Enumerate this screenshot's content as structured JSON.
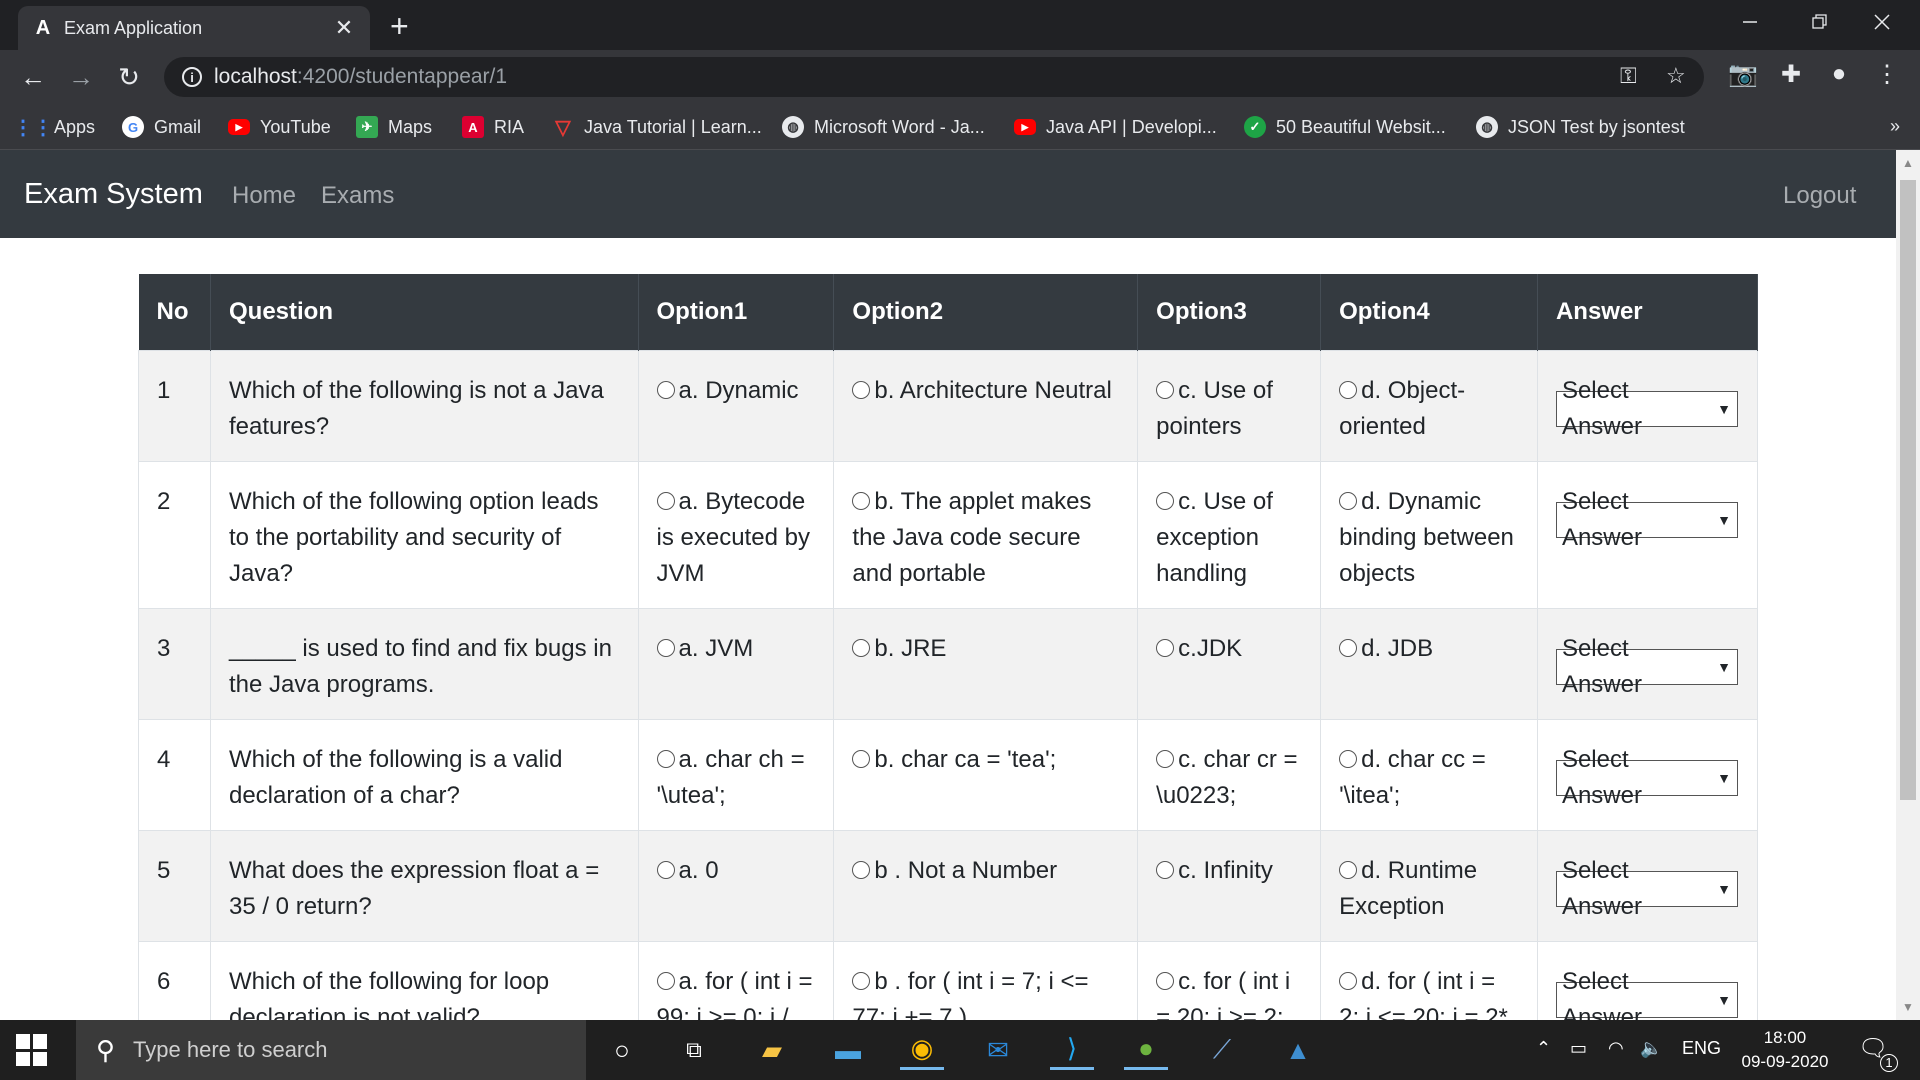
{
  "browser": {
    "tab_title": "Exam Application",
    "tab_close": "✕",
    "new_tab": "+",
    "url_host": "localhost",
    "url_path": ":4200/studentappear/1",
    "bookmarks": [
      {
        "label": "Apps",
        "icon": "apps-grid-icon",
        "color": "#4285f4"
      },
      {
        "label": "Gmail",
        "icon": "google-icon",
        "color": "#ea4335"
      },
      {
        "label": "YouTube",
        "icon": "youtube-icon",
        "color": "#ff0000"
      },
      {
        "label": "Maps",
        "icon": "maps-icon",
        "color": "#34a853"
      },
      {
        "label": "RIA",
        "icon": "angular-icon",
        "color": "#dd0031"
      },
      {
        "label": "Java Tutorial | Learn...",
        "icon": "java-tutorial-icon",
        "color": "#e53935"
      },
      {
        "label": "Microsoft Word - Ja...",
        "icon": "globe-icon",
        "color": "#e8eaed"
      },
      {
        "label": "Java API | Developi...",
        "icon": "youtube-icon",
        "color": "#ff0000"
      },
      {
        "label": "50 Beautiful Websit...",
        "icon": "check-icon",
        "color": "#1ea446"
      },
      {
        "label": "JSON Test by jsontest",
        "icon": "globe-icon",
        "color": "#e8eaed"
      }
    ],
    "bookmarks_more": "»"
  },
  "app": {
    "brand": "Exam System",
    "nav": [
      "Home",
      "Exams"
    ],
    "logout": "Logout"
  },
  "table": {
    "headers": [
      "No",
      "Question",
      "Option1",
      "Option2",
      "Option3",
      "Option4",
      "Answer"
    ],
    "select_placeholder": "Select Answer",
    "rows": [
      {
        "no": "1",
        "question": "Which of the following is not a Java features?",
        "options": [
          "a. Dynamic",
          "b. Architecture Neutral",
          "c. Use of pointers",
          "d. Object-oriented"
        ]
      },
      {
        "no": "2",
        "question": "Which of the following option leads to the portability and security of Java?",
        "options": [
          "a. Bytecode is executed by JVM",
          "b. The applet makes the Java code secure and portable",
          "c. Use of exception handling",
          "d. Dynamic binding between objects"
        ]
      },
      {
        "no": "3",
        "question": "_____ is used to find and fix bugs in the Java programs.",
        "options": [
          "a. JVM",
          "b. JRE",
          "c.JDK",
          "d. JDB"
        ]
      },
      {
        "no": "4",
        "question": "Which of the following is a valid declaration of a char?",
        "options": [
          "a. char ch = '\\utea';",
          "b. char ca = 'tea';",
          "c. char cr = \\u0223;",
          "d. char cc = '\\itea';"
        ]
      },
      {
        "no": "5",
        "question": "What does the expression float a = 35 / 0 return?",
        "options": [
          "a. 0",
          "b . Not a Number",
          "c. Infinity",
          "d. Runtime Exception"
        ]
      },
      {
        "no": "6",
        "question": "Which of the following for loop declaration is not valid?",
        "options": [
          "a. for ( int i = 99; i >= 0; i /",
          "b . for ( int i = 7; i <= 77; i += 7 )",
          "c. for ( int i = 20; i >= 2;",
          "d. for ( int i = 2; i <= 20; i = 2*"
        ]
      }
    ]
  },
  "taskbar": {
    "search_placeholder": "Type here to search",
    "lang": "ENG",
    "time": "18:00",
    "date": "09-09-2020",
    "notifications": "1"
  }
}
